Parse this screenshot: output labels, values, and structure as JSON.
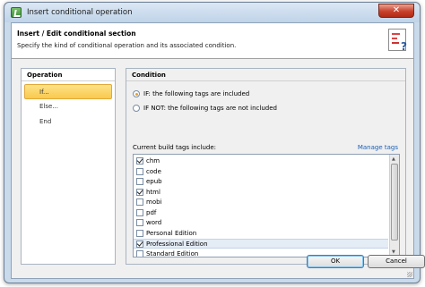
{
  "window": {
    "title": "Insert conditional operation",
    "close_glyph": "✕"
  },
  "header": {
    "title": "Insert / Edit conditional section",
    "subtitle": "Specify the kind of conditional operation and its associated condition."
  },
  "operation": {
    "heading": "Operation",
    "items": [
      {
        "label": "If...",
        "selected": true
      },
      {
        "label": "Else...",
        "selected": false
      },
      {
        "label": "End",
        "selected": false
      }
    ]
  },
  "condition": {
    "heading": "Condition",
    "options": [
      {
        "label": "IF: the following tags are included",
        "checked": true
      },
      {
        "label": "IF NOT: the following tags are not included",
        "checked": false
      }
    ],
    "tags_label": "Current build tags include:",
    "manage_link": "Manage tags",
    "tags": [
      {
        "label": "chm",
        "checked": true,
        "selected": false
      },
      {
        "label": "code",
        "checked": false,
        "selected": false
      },
      {
        "label": "epub",
        "checked": false,
        "selected": false
      },
      {
        "label": "html",
        "checked": true,
        "selected": false
      },
      {
        "label": "mobi",
        "checked": false,
        "selected": false
      },
      {
        "label": "pdf",
        "checked": false,
        "selected": false
      },
      {
        "label": "word",
        "checked": false,
        "selected": false
      },
      {
        "label": "Personal Edition",
        "checked": false,
        "selected": false
      },
      {
        "label": "Professional Edition",
        "checked": true,
        "selected": true
      },
      {
        "label": "Standard Edition",
        "checked": false,
        "selected": false
      }
    ]
  },
  "buttons": {
    "ok": "OK",
    "cancel": "Cancel"
  },
  "colors": {
    "accent_selected": "#f8c94f",
    "link": "#1a5fb4",
    "close": "#c9402a"
  }
}
